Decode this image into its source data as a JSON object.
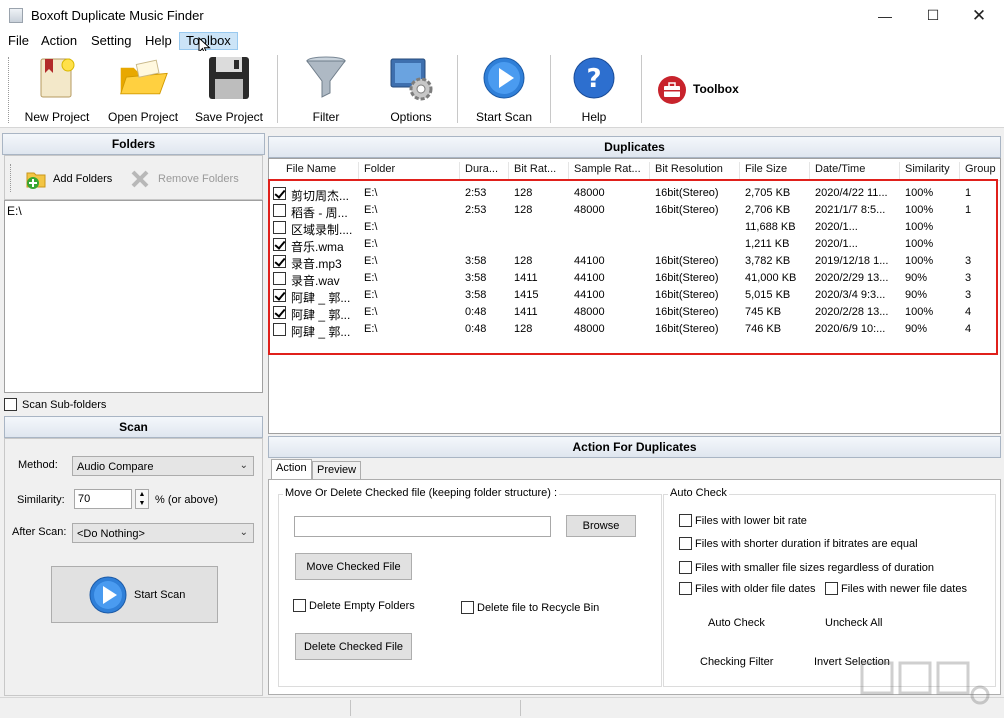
{
  "window": {
    "title": "Boxoft Duplicate Music Finder"
  },
  "menu": [
    "File",
    "Action",
    "Setting",
    "Help",
    "Toolbox"
  ],
  "toolbar": {
    "new_project": "New Project",
    "open_project": "Open Project",
    "save_project": "Save Project",
    "filter": "Filter",
    "options": "Options",
    "start_scan": "Start Scan",
    "help": "Help",
    "toolbox": "Toolbox"
  },
  "folders": {
    "title": "Folders",
    "add": "Add Folders",
    "remove": "Remove Folders",
    "items": [
      "E:\\"
    ],
    "scan_subfolders": "Scan Sub-folders"
  },
  "scan": {
    "title": "Scan",
    "method_label": "Method:",
    "method_value": "Audio Compare",
    "similarity_label": "Similarity:",
    "similarity_value": "70",
    "similarity_suffix": "% (or above)",
    "after_scan_label": "After Scan:",
    "after_scan_value": "<Do Nothing>",
    "start_button": "Start Scan"
  },
  "duplicates": {
    "title": "Duplicates",
    "columns": [
      "File Name",
      "Folder",
      "Dura...",
      "Bit Rat...",
      "Sample Rat...",
      "Bit Resolution",
      "File Size",
      "Date/Time",
      "Similarity",
      "Group"
    ],
    "rows": [
      {
        "checked": true,
        "cells": [
          "剪切周杰...",
          "E:\\",
          "2:53",
          "128",
          "48000",
          "16bit(Stereo)",
          "2,705 KB",
          "2020/4/22 11...",
          "100%",
          "1"
        ]
      },
      {
        "checked": false,
        "cells": [
          "稻香 - 周...",
          "E:\\",
          "2:53",
          "128",
          "48000",
          "16bit(Stereo)",
          "2,706 KB",
          "2021/1/7 8:5...",
          "100%",
          "1"
        ]
      },
      {
        "checked": false,
        "cells": [
          "区域录制....",
          "E:\\",
          "",
          "",
          "",
          "",
          "11,688 KB",
          "2020/1...",
          "100%",
          ""
        ]
      },
      {
        "checked": true,
        "cells": [
          "音乐.wma",
          "E:\\",
          "",
          "",
          "",
          "",
          "1,211 KB",
          "2020/1...",
          "100%",
          ""
        ]
      },
      {
        "checked": true,
        "cells": [
          "录音.mp3",
          "E:\\",
          "3:58",
          "128",
          "44100",
          "16bit(Stereo)",
          "3,782 KB",
          "2019/12/18 1...",
          "100%",
          "3"
        ]
      },
      {
        "checked": false,
        "cells": [
          "录音.wav",
          "E:\\",
          "3:58",
          "1411",
          "44100",
          "16bit(Stereo)",
          "41,000 KB",
          "2020/2/29 13...",
          "90%",
          "3"
        ]
      },
      {
        "checked": true,
        "cells": [
          "阿肆 _ 郭...",
          "E:\\",
          "3:58",
          "1415",
          "44100",
          "16bit(Stereo)",
          "5,015 KB",
          "2020/3/4 9:3...",
          "90%",
          "3"
        ]
      },
      {
        "checked": true,
        "cells": [
          "阿肆 _ 郭...",
          "E:\\",
          "0:48",
          "1411",
          "48000",
          "16bit(Stereo)",
          "745 KB",
          "2020/2/28 13...",
          "100%",
          "4"
        ]
      },
      {
        "checked": false,
        "cells": [
          "阿肆 _ 郭...",
          "E:\\",
          "0:48",
          "128",
          "48000",
          "16bit(Stereo)",
          "746 KB",
          "2020/6/9 10:...",
          "90%",
          "4"
        ]
      }
    ]
  },
  "actions": {
    "title": "Action For Duplicates",
    "tabs": [
      "Action",
      "Preview"
    ],
    "move_group": "Move Or Delete Checked file (keeping folder structure) :",
    "path_value": "",
    "browse": "Browse",
    "move_checked": "Move Checked File",
    "delete_empty_folders": "Delete Empty Folders",
    "delete_recycle": "Delete file to Recycle Bin",
    "delete_checked": "Delete Checked File",
    "auto_check_group": "Auto Check",
    "opt_lower_bitrate": "Files with lower bit rate",
    "opt_shorter_duration": "Files with shorter duration if bitrates are equal",
    "opt_smaller_size": "Files with smaller file sizes regardless of duration",
    "opt_older_dates": "Files with older file dates",
    "opt_newer_dates": "Files with newer file dates",
    "auto_check": "Auto Check",
    "uncheck_all": "Uncheck All",
    "checking_filter": "Checking Filter",
    "invert_selection": "Invert Selection"
  }
}
